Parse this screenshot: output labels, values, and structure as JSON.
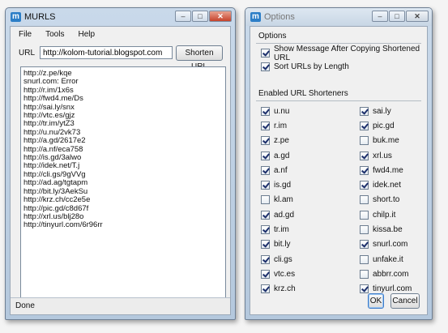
{
  "main_window": {
    "logo_text": "m",
    "title": "MURLS",
    "controls": {
      "minimize": "–",
      "maximize": "□",
      "close": "✕"
    },
    "menu": [
      {
        "label": "File"
      },
      {
        "label": "Tools"
      },
      {
        "label": "Help"
      }
    ],
    "url_label": "URL",
    "url_value": "http://kolom-tutorial.blogspot.com",
    "shorten_button": "Shorten URL",
    "results": [
      "http://z.pe/kqe",
      "snurl.com: Error",
      "http://r.im/1x6s",
      "http://fwd4.me/Ds",
      "http://sai.ly/snx",
      "http://vtc.es/gjz",
      "http://tr.im/ytZ3",
      "http://u.nu/2vk73",
      "http://a.gd/2617e2",
      "http://a.nf/eca758",
      "http://is.gd/3alwo",
      "http://idek.net/T.j",
      "http://cli.gs/9gVVg",
      "http://ad.ag/tgtapm",
      "http://bit.ly/3AekSu",
      "http://krz.ch/cc2e5e",
      "http://pic.gd/c8d67f",
      "http://xrl.us/blj28o",
      "http://tinyurl.com/6r96rr"
    ],
    "status": "Done"
  },
  "options_window": {
    "logo_text": "m",
    "title": "Options",
    "controls": {
      "minimize": "–",
      "maximize": "□",
      "close": "✕"
    },
    "options_group_label": "Options",
    "options": [
      {
        "label": "Show Message After Copying Shortened URL",
        "checked": true
      },
      {
        "label": "Sort URLs by Length",
        "checked": true
      }
    ],
    "shorteners_group_label": "Enabled URL Shorteners",
    "shorteners": [
      {
        "label": "u.nu",
        "checked": true
      },
      {
        "label": "sai.ly",
        "checked": true
      },
      {
        "label": "r.im",
        "checked": true
      },
      {
        "label": "pic.gd",
        "checked": true
      },
      {
        "label": "z.pe",
        "checked": true
      },
      {
        "label": "buk.me",
        "checked": false
      },
      {
        "label": "a.gd",
        "checked": true
      },
      {
        "label": "xrl.us",
        "checked": true
      },
      {
        "label": "a.nf",
        "checked": true
      },
      {
        "label": "fwd4.me",
        "checked": true
      },
      {
        "label": "is.gd",
        "checked": true
      },
      {
        "label": "idek.net",
        "checked": true
      },
      {
        "label": "kl.am",
        "checked": false
      },
      {
        "label": "short.to",
        "checked": false
      },
      {
        "label": "ad.gd",
        "checked": true
      },
      {
        "label": "chilp.it",
        "checked": false
      },
      {
        "label": "tr.im",
        "checked": true
      },
      {
        "label": "kissa.be",
        "checked": false
      },
      {
        "label": "bit.ly",
        "checked": true
      },
      {
        "label": "snurl.com",
        "checked": true
      },
      {
        "label": "cli.gs",
        "checked": true
      },
      {
        "label": "unfake.it",
        "checked": false
      },
      {
        "label": "vtc.es",
        "checked": true
      },
      {
        "label": "abbrr.com",
        "checked": false
      },
      {
        "label": "krz.ch",
        "checked": true
      },
      {
        "label": "tinyurl.com",
        "checked": true
      }
    ],
    "ok_button": "OK",
    "cancel_button": "Cancel"
  }
}
